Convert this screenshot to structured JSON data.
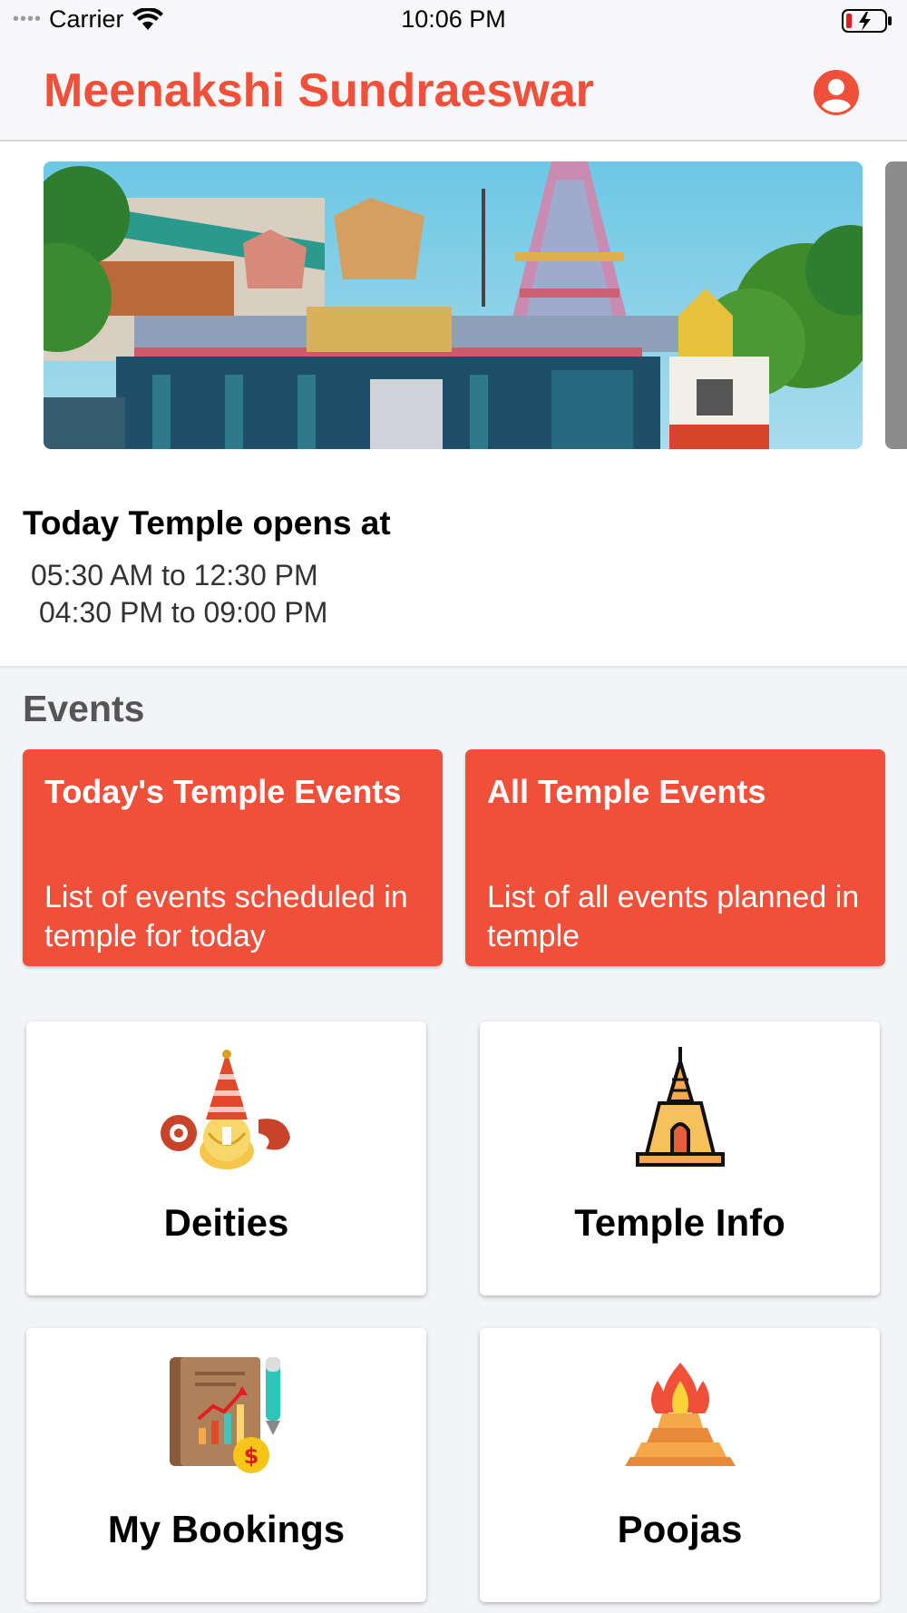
{
  "status_bar": {
    "carrier": "Carrier",
    "time": "10:06 PM"
  },
  "nav": {
    "title": "Meenakshi Sundraeswar",
    "profile_icon": "user-circle-icon"
  },
  "hero": {
    "image": "temple-gopuram-photo"
  },
  "timings": {
    "heading": "Today Temple opens at",
    "slots": [
      "05:30 AM to 12:30 PM",
      "04:30 PM to 09:00 PM"
    ]
  },
  "events": {
    "heading": "Events",
    "cards": [
      {
        "title": "Today's Temple Events",
        "description": "List of events scheduled in temple for today"
      },
      {
        "title": "All Temple Events",
        "description": "List of all events planned in temple"
      }
    ]
  },
  "tiles": [
    {
      "label": "Deities",
      "icon": "deity-icon"
    },
    {
      "label": "Temple Info",
      "icon": "temple-tower-icon"
    },
    {
      "label": "My Bookings",
      "icon": "ledger-book-icon"
    },
    {
      "label": "Poojas",
      "icon": "havan-fire-icon"
    }
  ],
  "colors": {
    "accent": "#f0503a",
    "background": "#f3f4f8"
  }
}
